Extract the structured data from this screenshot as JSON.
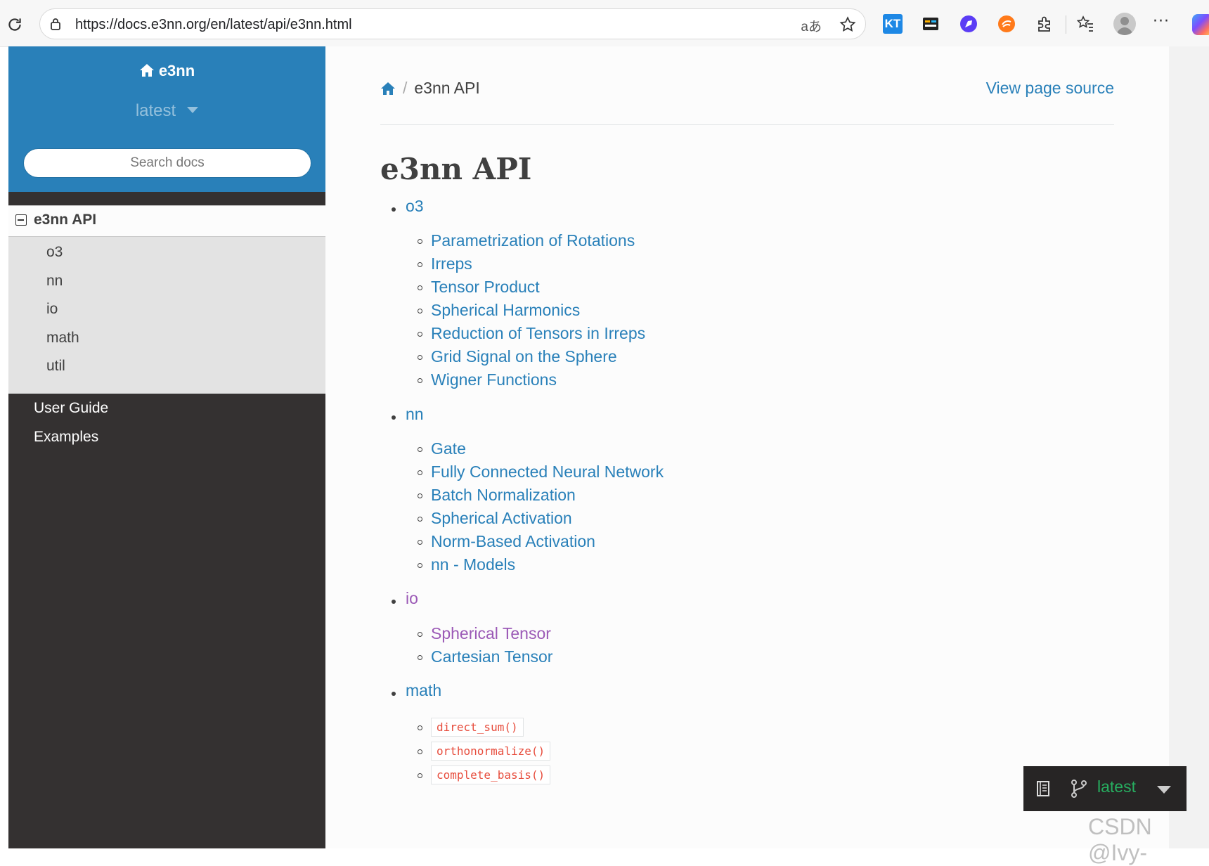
{
  "browser": {
    "url": "https://docs.e3nn.org/en/latest/api/e3nn.html",
    "translate_label": "aあ",
    "more_label": "···",
    "kt_label": "KT"
  },
  "sidebar": {
    "brand": "e3nn",
    "version": "latest",
    "search_placeholder": "Search docs",
    "current": "e3nn API",
    "sub_items": [
      "o3",
      "nn",
      "io",
      "math",
      "util"
    ],
    "top_items": [
      "User Guide",
      "Examples"
    ]
  },
  "content": {
    "breadcrumb_current": "e3nn API",
    "view_source": "View page source",
    "title": "e3nn API",
    "sections": [
      {
        "label": "o3",
        "items": [
          {
            "label": "Parametrization of Rotations",
            "visited": false
          },
          {
            "label": "Irreps",
            "visited": false
          },
          {
            "label": "Tensor Product",
            "visited": false
          },
          {
            "label": "Spherical Harmonics",
            "visited": false
          },
          {
            "label": "Reduction of Tensors in Irreps",
            "visited": false
          },
          {
            "label": "Grid Signal on the Sphere",
            "visited": false
          },
          {
            "label": "Wigner Functions",
            "visited": false
          }
        ]
      },
      {
        "label": "nn",
        "items": [
          {
            "label": "Gate",
            "visited": false
          },
          {
            "label": "Fully Connected Neural Network",
            "visited": false
          },
          {
            "label": "Batch Normalization",
            "visited": false
          },
          {
            "label": "Spherical Activation",
            "visited": false
          },
          {
            "label": "Norm-Based Activation",
            "visited": false
          },
          {
            "label": "nn - Models",
            "visited": false
          }
        ]
      },
      {
        "label": "io",
        "visited": true,
        "items": [
          {
            "label": "Spherical Tensor",
            "visited": true
          },
          {
            "label": "Cartesian Tensor",
            "visited": false
          }
        ]
      },
      {
        "label": "math",
        "items": [
          {
            "label": "direct_sum()",
            "code": true
          },
          {
            "label": "orthonormalize()",
            "code": true
          },
          {
            "label": "complete_basis()",
            "code": true
          }
        ]
      }
    ]
  },
  "version_badge": {
    "label": "latest"
  },
  "watermark": "CSDN @Ivy-",
  "colors": {
    "link": "#2980b9",
    "visited": "#9b59b6",
    "sidebar_top": "#2980b9",
    "sidebar_bg": "#343131",
    "code": "#e74c3c",
    "badge_green": "#27ae60"
  }
}
